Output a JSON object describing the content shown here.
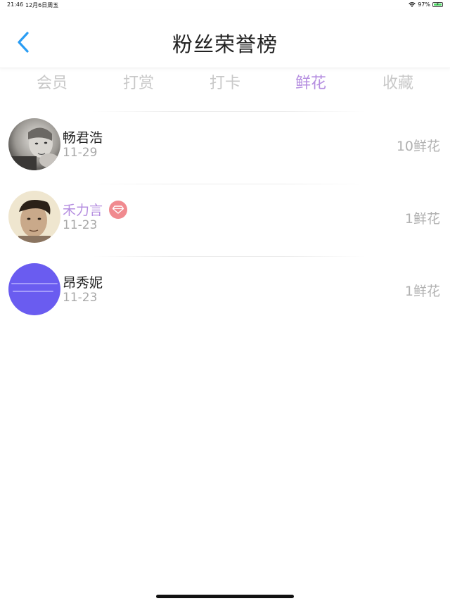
{
  "status_bar": {
    "time": "21:46",
    "date": "12月6日周五",
    "battery": "97%",
    "battery_level": 0.97
  },
  "header": {
    "title": "粉丝荣誉榜"
  },
  "tabs": [
    {
      "label": "会员",
      "active": false
    },
    {
      "label": "打赏",
      "active": false
    },
    {
      "label": "打卡",
      "active": false
    },
    {
      "label": "鲜花",
      "active": true
    },
    {
      "label": "收藏",
      "active": false
    }
  ],
  "rows": [
    {
      "name": "畅君浩",
      "date": "11-29",
      "count": "10鲜花",
      "vip": false,
      "avatar": "photo-child-avatar"
    },
    {
      "name": "禾力言",
      "date": "11-23",
      "count": "1鲜花",
      "vip": true,
      "avatar": "photo-man-avatar"
    },
    {
      "name": "昂秀妮",
      "date": "11-23",
      "count": "1鲜花",
      "vip": false,
      "avatar": "purple-text-avatar"
    }
  ],
  "colors": {
    "accent": "#b58ee0",
    "back": "#2a9df4",
    "vip_badge": "#f08a8f",
    "muted": "#c8c8c8"
  }
}
